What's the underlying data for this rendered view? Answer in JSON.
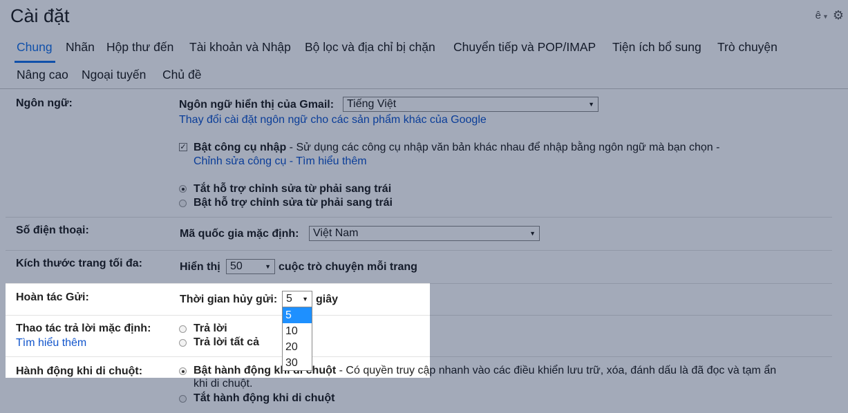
{
  "header": {
    "title": "Cài đặt",
    "account_initial": "ê"
  },
  "tabs": {
    "general": "Chung",
    "labels": "Nhãn",
    "inbox": "Hộp thư đến",
    "accounts": "Tài khoản và Nhập",
    "filters": "Bộ lọc và địa chỉ bị chặn",
    "forwarding": "Chuyển tiếp và POP/IMAP",
    "addons": "Tiện ích bổ sung",
    "chat": "Trò chuyện",
    "advanced": "Nâng cao",
    "offline": "Ngoại tuyến",
    "themes": "Chủ đề"
  },
  "language": {
    "label": "Ngôn ngữ:",
    "display_label": "Ngôn ngữ hiển thị của Gmail:",
    "display_value": "Tiếng Việt",
    "change_link": "Thay đổi cài đặt ngôn ngữ cho các sản phẩm khác của Google",
    "input_tools_label": "Bật công cụ nhập",
    "input_tools_desc": " - Sử dụng các công cụ nhập văn bản khác nhau để nhập bằng ngôn ngữ mà bạn chọn -",
    "edit_tools_link": "Chỉnh sửa công cụ",
    "sep": " - ",
    "learn_more_link": "Tìm hiểu thêm",
    "rtl_off": "Tắt hỗ trợ chỉnh sửa từ phải sang trái",
    "rtl_on": "Bật hỗ trợ chỉnh sửa từ phải sang trái"
  },
  "phone": {
    "label": "Số điện thoại:",
    "country_label": "Mã quốc gia mặc định:",
    "country_value": "Việt Nam"
  },
  "page_size": {
    "label": "Kích thước trang tối đa:",
    "show": "Hiển thị",
    "value": "50",
    "suffix": "cuộc trò chuyện mỗi trang"
  },
  "undo_send": {
    "label": "Hoàn tác Gửi:",
    "period_label": "Thời gian hủy gửi:",
    "value": "5",
    "unit": "giây",
    "options": [
      "5",
      "10",
      "20",
      "30"
    ]
  },
  "reply": {
    "label": "Thao tác trả lời mặc định:",
    "learn_more": "Tìm hiểu thêm",
    "reply": "Trả lời",
    "reply_all": "Trả lời tất cả"
  },
  "hover": {
    "label": "Hành động khi di chuột:",
    "enable_label": "Bật hành động khi di chuột",
    "enable_desc_1": " - Có quyền truy cập nhanh vào các điều khiển lưu trữ, xóa, đánh dấu là đã đọc và tạm ẩn",
    "enable_desc_2": "khi di chuột.",
    "disable_label": "Tắt hành động khi di chuột"
  }
}
